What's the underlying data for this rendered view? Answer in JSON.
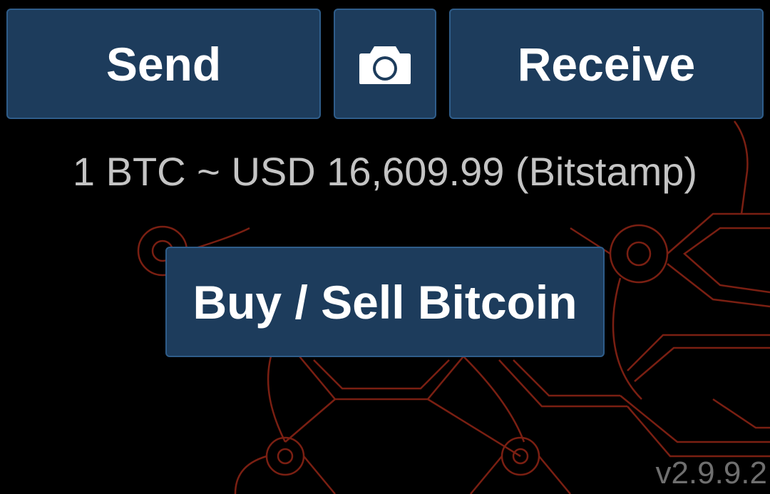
{
  "actions": {
    "send_label": "Send",
    "receive_label": "Receive",
    "camera_icon": "camera-icon",
    "buy_sell_label": "Buy / Sell Bitcoin"
  },
  "exchange_rate": {
    "text": "1 BTC ~ USD 16,609.99 (Bitstamp)"
  },
  "footer": {
    "version": "v2.9.9.2"
  },
  "colors": {
    "background": "#000000",
    "button_fill": "#1d3c5c",
    "button_border": "#2f5d8a",
    "button_text": "#ffffff",
    "rate_text": "#c4c4c4",
    "pattern_stroke": "#7a1f12"
  }
}
